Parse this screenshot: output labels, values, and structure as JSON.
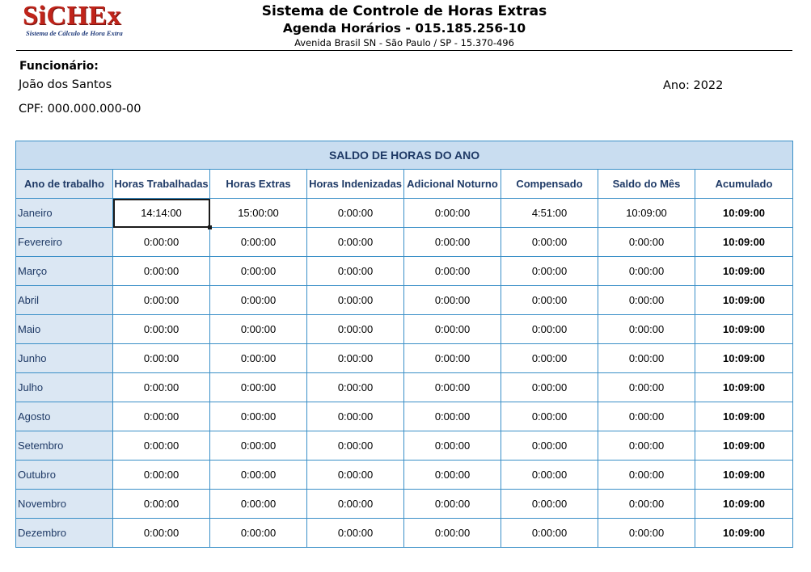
{
  "logo": {
    "name": "SiCHEx",
    "tagline": "Sistema de Cálculo de Hora Extra"
  },
  "header": {
    "title": "Sistema de Controle de Horas Extras",
    "subtitle": "Agenda Horários - 015.185.256-10",
    "address": "Avenida Brasil SN - São Paulo / SP - 15.370-496"
  },
  "employee": {
    "label": "Funcionário:",
    "name": "João dos Santos",
    "cpf": "CPF: 000.000.000-00",
    "year": "Ano: 2022"
  },
  "table": {
    "title": "SALDO DE HORAS DO ANO",
    "columns": [
      "Ano de trabalho",
      "Horas Trabalhadas",
      "Horas Extras",
      "Horas Indenizadas",
      "Adicional Noturno",
      "Compensado",
      "Saldo do Mês",
      "Acumulado"
    ],
    "rows": [
      [
        "Janeiro",
        "14:14:00",
        "15:00:00",
        "0:00:00",
        "0:00:00",
        "4:51:00",
        "10:09:00",
        "10:09:00"
      ],
      [
        "Fevereiro",
        "0:00:00",
        "0:00:00",
        "0:00:00",
        "0:00:00",
        "0:00:00",
        "0:00:00",
        "10:09:00"
      ],
      [
        "Março",
        "0:00:00",
        "0:00:00",
        "0:00:00",
        "0:00:00",
        "0:00:00",
        "0:00:00",
        "10:09:00"
      ],
      [
        "Abril",
        "0:00:00",
        "0:00:00",
        "0:00:00",
        "0:00:00",
        "0:00:00",
        "0:00:00",
        "10:09:00"
      ],
      [
        "Maio",
        "0:00:00",
        "0:00:00",
        "0:00:00",
        "0:00:00",
        "0:00:00",
        "0:00:00",
        "10:09:00"
      ],
      [
        "Junho",
        "0:00:00",
        "0:00:00",
        "0:00:00",
        "0:00:00",
        "0:00:00",
        "0:00:00",
        "10:09:00"
      ],
      [
        "Julho",
        "0:00:00",
        "0:00:00",
        "0:00:00",
        "0:00:00",
        "0:00:00",
        "0:00:00",
        "10:09:00"
      ],
      [
        "Agosto",
        "0:00:00",
        "0:00:00",
        "0:00:00",
        "0:00:00",
        "0:00:00",
        "0:00:00",
        "10:09:00"
      ],
      [
        "Setembro",
        "0:00:00",
        "0:00:00",
        "0:00:00",
        "0:00:00",
        "0:00:00",
        "0:00:00",
        "10:09:00"
      ],
      [
        "Outubro",
        "0:00:00",
        "0:00:00",
        "0:00:00",
        "0:00:00",
        "0:00:00",
        "0:00:00",
        "10:09:00"
      ],
      [
        "Novembro",
        "0:00:00",
        "0:00:00",
        "0:00:00",
        "0:00:00",
        "0:00:00",
        "0:00:00",
        "10:09:00"
      ],
      [
        "Dezembro",
        "0:00:00",
        "0:00:00",
        "0:00:00",
        "0:00:00",
        "0:00:00",
        "0:00:00",
        "10:09:00"
      ]
    ]
  },
  "colors": {
    "border": "#3a8fc7",
    "header_bg": "#c9ddf0",
    "month_bg": "#dbe7f3",
    "header_text": "#1f3a66",
    "logo_red": "#c0241a"
  }
}
